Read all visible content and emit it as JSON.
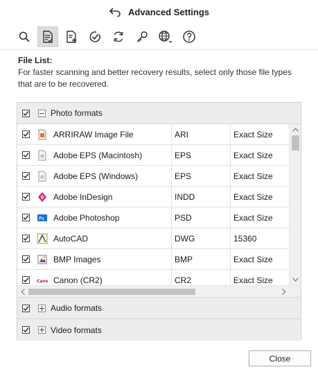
{
  "window": {
    "title": "Advanced Settings",
    "back_icon": "back-arrow-icon"
  },
  "toolbar": {
    "items": [
      {
        "name": "search-icon"
      },
      {
        "name": "file-list-icon",
        "active": true
      },
      {
        "name": "add-file-icon"
      },
      {
        "name": "check-circle-icon"
      },
      {
        "name": "refresh-icon"
      },
      {
        "name": "key-icon"
      },
      {
        "name": "globe-icon"
      },
      {
        "name": "help-icon"
      }
    ]
  },
  "file_list": {
    "heading": "File List:",
    "description": "For faster scanning and better recovery results, select only those file types that are to be recovered."
  },
  "groups": {
    "photo": {
      "label": "Photo formats",
      "checked": true,
      "expanded": true,
      "rows": [
        {
          "name": "ARRIRAW Image File",
          "ext": "ARI",
          "size": "Exact Size",
          "icon": "arriraw-icon"
        },
        {
          "name": "Adobe EPS (Macintosh)",
          "ext": "EPS",
          "size": "Exact Size",
          "icon": "eps-icon"
        },
        {
          "name": "Adobe EPS (Windows)",
          "ext": "EPS",
          "size": "Exact Size",
          "icon": "eps-icon"
        },
        {
          "name": "Adobe InDesign",
          "ext": "INDD",
          "size": "Exact Size",
          "icon": "indesign-icon"
        },
        {
          "name": "Adobe Photoshop",
          "ext": "PSD",
          "size": "Exact Size",
          "icon": "photoshop-icon"
        },
        {
          "name": "AutoCAD",
          "ext": "DWG",
          "size": "15360",
          "icon": "autocad-icon"
        },
        {
          "name": "BMP Images",
          "ext": "BMP",
          "size": "Exact Size",
          "icon": "bmp-icon"
        },
        {
          "name": "Canon (CR2)",
          "ext": "CR2",
          "size": "Exact Size",
          "icon": "canon-icon"
        }
      ]
    },
    "audio": {
      "label": "Audio formats",
      "checked": true,
      "expanded": false
    },
    "video": {
      "label": "Video formats",
      "checked": true,
      "expanded": false
    }
  },
  "footer": {
    "close_label": "Close"
  },
  "colors": {
    "panel_header": "#ededed",
    "active_tool": "#dcdcdc",
    "canon_red": "#c8102e",
    "ps_blue": "#1e6fd9"
  }
}
